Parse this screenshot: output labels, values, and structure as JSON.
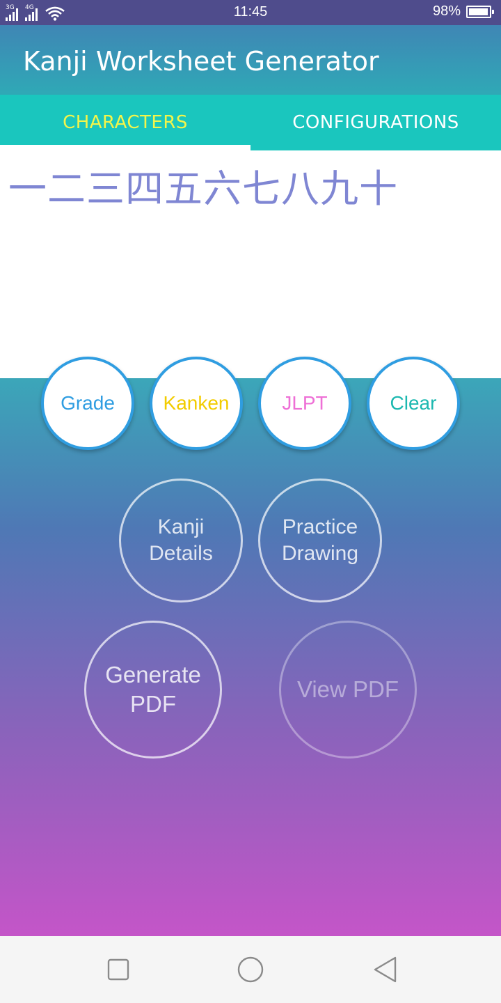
{
  "status_bar": {
    "sim1_label": "3G",
    "sim2_label": "4G",
    "time": "11:45",
    "battery_percent_text": "98%",
    "battery_level": 0.98
  },
  "app_bar": {
    "title": "Kanji Worksheet Generator"
  },
  "tabs": [
    {
      "label": "CHARACTERS",
      "active": true
    },
    {
      "label": "CONFIGURATIONS",
      "active": false
    }
  ],
  "characters": {
    "value": "一二三四五六七八九十"
  },
  "filters": {
    "grade": {
      "label": "Grade",
      "color": "#2f9de1"
    },
    "kanken": {
      "label": "Kanken",
      "color": "#f2cc00"
    },
    "jlpt": {
      "label": "JLPT",
      "color": "#ee6fd6"
    },
    "clear": {
      "label": "Clear",
      "color": "#1cb8b0"
    }
  },
  "actions": {
    "kanji_details": "Kanji\nDetails",
    "practice_drawing": "Practice\nDrawing",
    "generate_pdf": "Generate\nPDF",
    "view_pdf": "View PDF"
  },
  "nav": {
    "recents_icon": "square-icon",
    "home_icon": "circle-icon",
    "back_icon": "triangle-back-icon"
  }
}
